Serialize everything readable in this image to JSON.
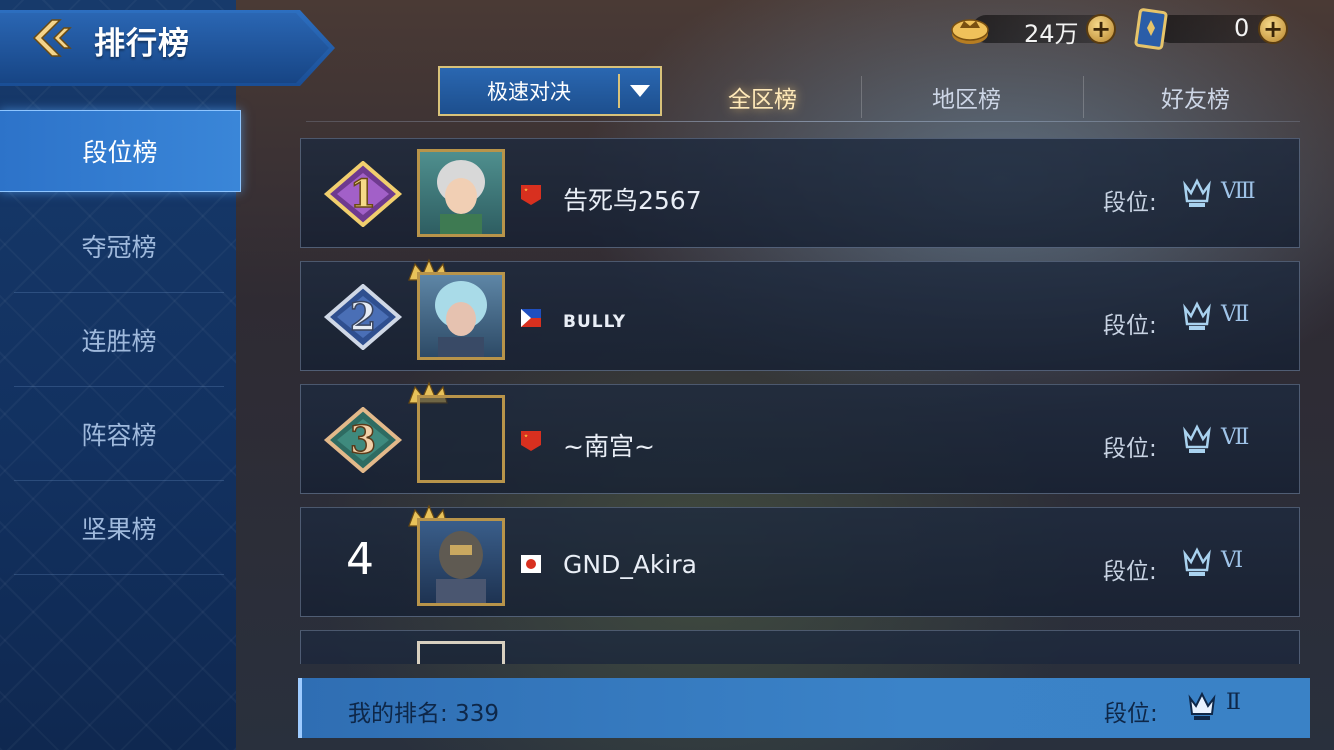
{
  "header": {
    "title": "排行榜",
    "back_icon": "back-arrow-icon"
  },
  "sidebar": {
    "items": [
      {
        "label": "段位榜",
        "active": true
      },
      {
        "label": "夺冠榜",
        "active": false
      },
      {
        "label": "连胜榜",
        "active": false
      },
      {
        "label": "阵容榜",
        "active": false
      },
      {
        "label": "坚果榜",
        "active": false
      }
    ]
  },
  "currency": {
    "gold": {
      "amount": "24万",
      "icon": "gold-coin-icon"
    },
    "tickets": {
      "amount": "0",
      "icon": "ticket-card-icon"
    }
  },
  "filter": {
    "mode_selected": "极速对决",
    "tabs": [
      {
        "label": "全区榜",
        "active": true
      },
      {
        "label": "地区榜",
        "active": false
      },
      {
        "label": "好友榜",
        "active": false
      }
    ]
  },
  "rows": [
    {
      "rank": "1",
      "name": "告死鸟2567",
      "flag": "cn",
      "tier_label": "段位:",
      "tier": "Ⅷ"
    },
    {
      "rank": "2",
      "name": "BULLY",
      "flag": "ph",
      "tier_label": "段位:",
      "tier": "Ⅶ"
    },
    {
      "rank": "3",
      "name": "~南宫~",
      "flag": "cn",
      "tier_label": "段位:",
      "tier": "Ⅶ"
    },
    {
      "rank": "4",
      "name": "GND_Akira",
      "flag": "jp",
      "tier_label": "段位:",
      "tier": "Ⅵ"
    }
  ],
  "my_rank": {
    "label": "我的排名: 339",
    "tier_label": "段位:",
    "tier": "Ⅱ"
  },
  "colors": {
    "accent_gold": "#d8c27a",
    "sidebar_active": "#3a86d8",
    "my_rank_bar": "#3b83c8"
  }
}
